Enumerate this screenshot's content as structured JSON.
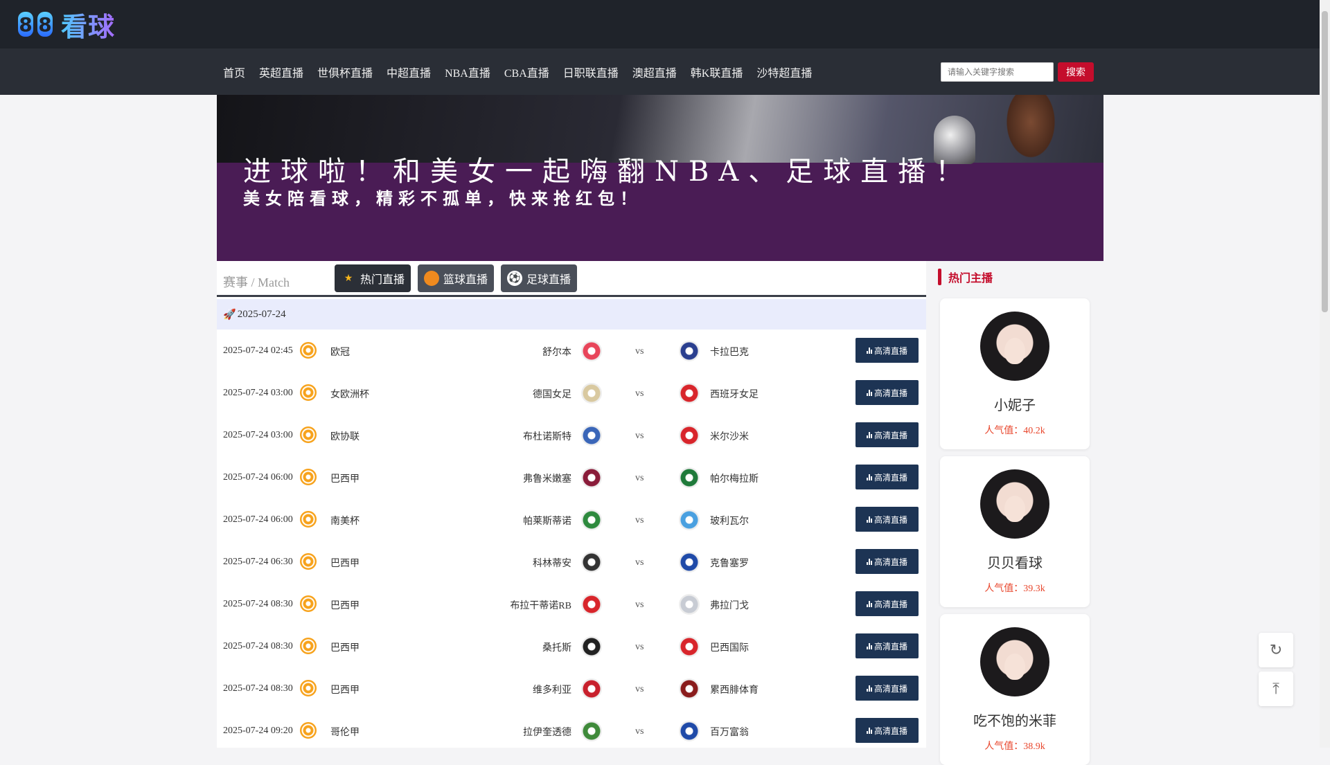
{
  "logo": {
    "digit1": "8",
    "digit2": "8",
    "text": "看球"
  },
  "nav": [
    "首页",
    "英超直播",
    "世俱杯直播",
    "中超直播",
    "NBA直播",
    "CBA直播",
    "日职联直播",
    "澳超直播",
    "韩K联直播",
    "沙特超直播"
  ],
  "search": {
    "placeholder": "请输入关键字搜索",
    "button": "搜索"
  },
  "banner": {
    "headline": "进球啦！和美女一起嗨翻NBA、足球直播！",
    "subline": "美女陪看球，精彩不孤单，快来抢红包！"
  },
  "main": {
    "title": "赛事 / Match",
    "tabs": [
      {
        "label": "热门直播",
        "icon": "star-icon"
      },
      {
        "label": "篮球直播",
        "icon": "basketball-icon"
      },
      {
        "label": "足球直播",
        "icon": "soccer-icon"
      }
    ],
    "date": "2025-07-24",
    "vs_label": "vs",
    "button_label": "高清直播",
    "matches": [
      {
        "time": "2025-07-24 02:45",
        "league": "欧冠",
        "home": "舒尔本",
        "away": "卡拉巴克",
        "home_color": "#e8455a",
        "away_color": "#2a3f8f"
      },
      {
        "time": "2025-07-24 03:00",
        "league": "女欧洲杯",
        "home": "德国女足",
        "away": "西班牙女足",
        "home_color": "#d9c9a0",
        "away_color": "#d8252b"
      },
      {
        "time": "2025-07-24 03:00",
        "league": "欧协联",
        "home": "布杜诺斯特",
        "away": "米尔沙米",
        "home_color": "#3a66b8",
        "away_color": "#d8252b"
      },
      {
        "time": "2025-07-24 06:00",
        "league": "巴西甲",
        "home": "弗鲁米嫩塞",
        "away": "帕尔梅拉斯",
        "home_color": "#8a1c3a",
        "away_color": "#1f7a3a"
      },
      {
        "time": "2025-07-24 06:00",
        "league": "南美杯",
        "home": "帕莱斯蒂诺",
        "away": "玻利瓦尔",
        "home_color": "#2e8a3e",
        "away_color": "#4aa0e0"
      },
      {
        "time": "2025-07-24 06:30",
        "league": "巴西甲",
        "home": "科林蒂安",
        "away": "克鲁塞罗",
        "home_color": "#333333",
        "away_color": "#1f4aa8"
      },
      {
        "time": "2025-07-24 08:30",
        "league": "巴西甲",
        "home": "布拉干蒂诺RB",
        "away": "弗拉门戈",
        "home_color": "#d8252b",
        "away_color": "#c8ccd4"
      },
      {
        "time": "2025-07-24 08:30",
        "league": "巴西甲",
        "home": "桑托斯",
        "away": "巴西国际",
        "home_color": "#222222",
        "away_color": "#d8252b"
      },
      {
        "time": "2025-07-24 08:30",
        "league": "巴西甲",
        "home": "维多利亚",
        "away": "累西腓体育",
        "home_color": "#c8202c",
        "away_color": "#8a1c1c"
      },
      {
        "time": "2025-07-24 09:20",
        "league": "哥伦甲",
        "home": "拉伊奎透德",
        "away": "百万富翁",
        "home_color": "#3f8a3a",
        "away_color": "#1f4aa8"
      }
    ]
  },
  "sidebar": {
    "title": "热门主播",
    "anchors": [
      {
        "name": "小妮子",
        "popularity": "人气值：40.2k"
      },
      {
        "name": "贝贝看球",
        "popularity": "人气值：39.3k"
      },
      {
        "name": "吃不饱的米菲",
        "popularity": "人气值：38.9k"
      }
    ]
  },
  "float": {
    "refresh_icon": "refresh-icon",
    "top_icon": "back-to-top-icon"
  }
}
